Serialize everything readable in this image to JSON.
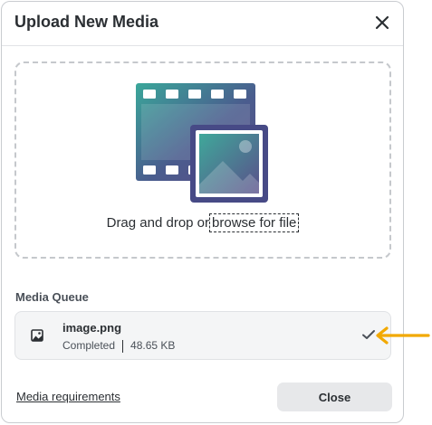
{
  "dialog": {
    "title": "Upload New Media",
    "close_icon": "close-icon"
  },
  "dropzone": {
    "illustration_icon": "film-image-icon",
    "prefix": "Drag and drop or",
    "browse_label": "browse for file"
  },
  "queue": {
    "label": "Media Queue",
    "items": [
      {
        "icon": "image-icon",
        "name": "image.png",
        "status": "Completed",
        "size": "48.65 KB",
        "status_icon": "check-icon"
      }
    ]
  },
  "annotation": {
    "icon": "arrow-left-icon",
    "color": "#f2a900"
  },
  "footer": {
    "requirements_link": "Media requirements",
    "close_label": "Close"
  }
}
